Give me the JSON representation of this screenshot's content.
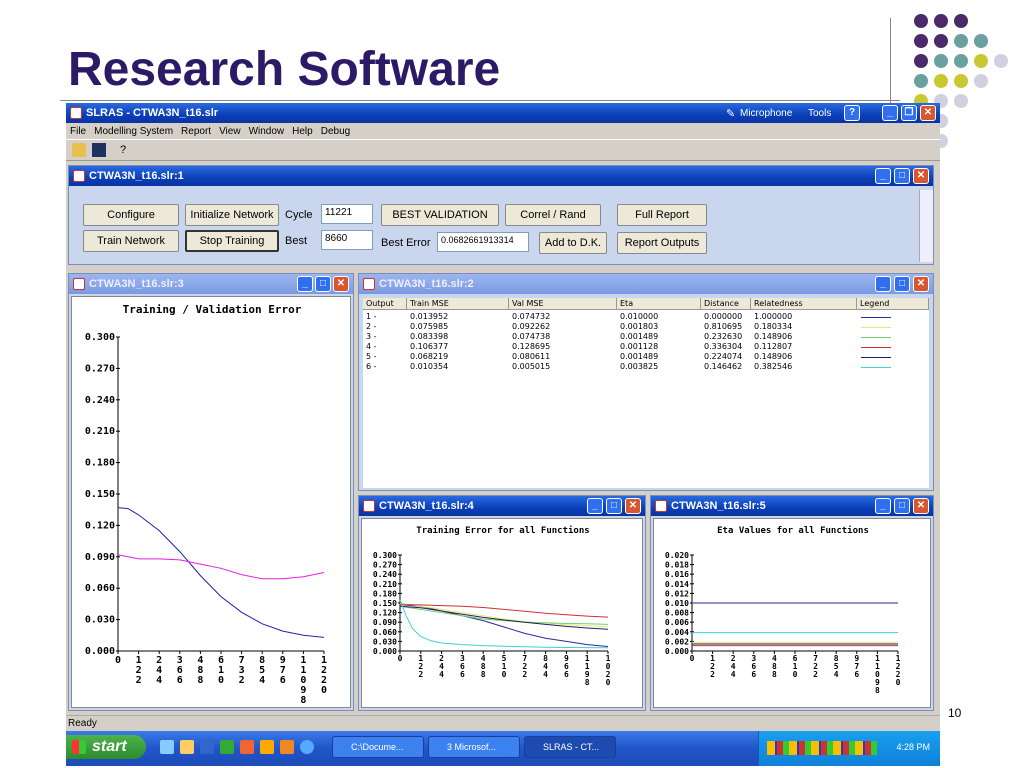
{
  "slide": {
    "title": "Research Software",
    "page_number": "10",
    "dot_colors": [
      "#4b2a6b",
      "#6aa0a0",
      "#c8c832",
      "#d0d0e0"
    ]
  },
  "app": {
    "title": "SLRAS - CTWA3N_t16.slr",
    "top_right": {
      "microphone": "Microphone",
      "tools": "Tools"
    },
    "menu": [
      "File",
      "Modelling System",
      "Report",
      "View",
      "Window",
      "Help",
      "Debug"
    ],
    "status": "Ready"
  },
  "control": {
    "title": "CTWA3N_t16.slr:1",
    "buttons": {
      "configure": "Configure",
      "init_network": "Initialize Network",
      "train_network": "Train Network",
      "stop_training": "Stop Training",
      "best_validation": "BEST VALIDATION",
      "correl_rand": "Correl / Rand",
      "full_report": "Full Report",
      "add_dk": "Add to D.K.",
      "report_outputs": "Report Outputs"
    },
    "labels": {
      "cycle": "Cycle",
      "best": "Best",
      "best_error": "Best Error"
    },
    "values": {
      "cycle": "11221",
      "best": "8660",
      "best_error": "0.0682661913314"
    }
  },
  "win3": {
    "title": "CTWA3N_t16.slr:3"
  },
  "win2": {
    "title": "CTWA3N_t16.slr:2"
  },
  "win4": {
    "title": "CTWA3N_t16.slr:4"
  },
  "win5": {
    "title": "CTWA3N_t16.slr:5"
  },
  "table": {
    "headers": [
      "Output",
      "Train MSE",
      "Val MSE",
      "Eta",
      "Distance",
      "Relatedness",
      "Legend"
    ],
    "rows": [
      {
        "output": "1 -",
        "train": "0.013952",
        "val": "0.074732",
        "eta": "0.010000",
        "dist": "0.000000",
        "rel": "1.000000",
        "color": "#2a2a9a"
      },
      {
        "output": "2 -",
        "train": "0.075985",
        "val": "0.092262",
        "eta": "0.001803",
        "dist": "0.810695",
        "rel": "0.180334",
        "color": "#e8e870"
      },
      {
        "output": "3 -",
        "train": "0.083398",
        "val": "0.074738",
        "eta": "0.001489",
        "dist": "0.232630",
        "rel": "0.148906",
        "color": "#70d070"
      },
      {
        "output": "4 -",
        "train": "0.106377",
        "val": "0.128695",
        "eta": "0.001128",
        "dist": "0.336304",
        "rel": "0.112807",
        "color": "#d03030"
      },
      {
        "output": "5 -",
        "train": "0.068219",
        "val": "0.080611",
        "eta": "0.001489",
        "dist": "0.224074",
        "rel": "0.148906",
        "color": "#202060"
      },
      {
        "output": "6 -",
        "train": "0.010354",
        "val": "0.005015",
        "eta": "0.003825",
        "dist": "0.146462",
        "rel": "0.382546",
        "color": "#40d0d0"
      }
    ]
  },
  "taskbar": {
    "start": "start",
    "tasks": [
      "C:\\Docume...",
      "3 Microsof...",
      "SLRAS - CT..."
    ],
    "clock": "4:28 PM"
  },
  "chart_data": [
    {
      "type": "line",
      "title": "Training / Validation Error",
      "ylim": [
        0,
        0.3
      ],
      "y_ticks": [
        "0.300",
        "0.270",
        "0.240",
        "0.210",
        "0.180",
        "0.150",
        "0.120",
        "0.090",
        "0.060",
        "0.030",
        "0.000"
      ],
      "x_ticks": [
        "0",
        "12\n2",
        "24\n4",
        "36\n6",
        "48\n8",
        "61\n0",
        "73\n2",
        "85\n4",
        "97\n6",
        "110\n98",
        "122\n0"
      ],
      "series": [
        {
          "color": "#2020b0",
          "x": [
            0,
            0.5,
            1,
            2,
            3,
            4,
            5,
            6,
            7,
            8,
            9,
            10
          ],
          "y": [
            0.137,
            0.136,
            0.13,
            0.115,
            0.095,
            0.072,
            0.052,
            0.037,
            0.026,
            0.019,
            0.015,
            0.013
          ]
        },
        {
          "color": "#e020e0",
          "x": [
            0,
            0.5,
            1,
            2,
            3,
            4,
            5,
            6,
            7,
            8,
            9,
            10
          ],
          "y": [
            0.092,
            0.09,
            0.088,
            0.088,
            0.087,
            0.083,
            0.079,
            0.073,
            0.069,
            0.069,
            0.071,
            0.075
          ]
        }
      ]
    },
    {
      "type": "line",
      "title": "Training Error for all Functions",
      "ylim": [
        0,
        0.3
      ],
      "y_ticks": [
        "0.300",
        "0.270",
        "0.240",
        "0.210",
        "0.180",
        "0.150",
        "0.120",
        "0.090",
        "0.060",
        "0.030",
        "0.000"
      ],
      "x_ticks": [
        "0",
        "12\n2",
        "24\n4",
        "36\n6",
        "48\n8",
        "51\n0",
        "72\n2",
        "84\n4",
        "96\n6",
        "119\n8",
        "102\n0"
      ],
      "series": [
        {
          "color": "#2a2a9a",
          "x": [
            0,
            1,
            2,
            3,
            4,
            5,
            6,
            7,
            8,
            9,
            10
          ],
          "y": [
            0.145,
            0.14,
            0.125,
            0.11,
            0.095,
            0.075,
            0.055,
            0.04,
            0.03,
            0.02,
            0.014
          ]
        },
        {
          "color": "#e8e870",
          "x": [
            0,
            1,
            2,
            3,
            4,
            5,
            6,
            7,
            8,
            9,
            10
          ],
          "y": [
            0.15,
            0.14,
            0.13,
            0.12,
            0.11,
            0.1,
            0.092,
            0.087,
            0.082,
            0.079,
            0.076
          ]
        },
        {
          "color": "#70d070",
          "x": [
            0,
            1,
            2,
            3,
            4,
            5,
            6,
            7,
            8,
            9,
            10
          ],
          "y": [
            0.14,
            0.13,
            0.12,
            0.11,
            0.1,
            0.095,
            0.09,
            0.088,
            0.086,
            0.085,
            0.083
          ]
        },
        {
          "color": "#d03030",
          "x": [
            0,
            1,
            2,
            3,
            4,
            5,
            6,
            7,
            8,
            9,
            10
          ],
          "y": [
            0.145,
            0.144,
            0.142,
            0.14,
            0.136,
            0.13,
            0.124,
            0.118,
            0.113,
            0.109,
            0.106
          ]
        },
        {
          "color": "#202060",
          "x": [
            0,
            1,
            2,
            3,
            4,
            5,
            6,
            7,
            8,
            9,
            10
          ],
          "y": [
            0.14,
            0.135,
            0.125,
            0.115,
            0.105,
            0.097,
            0.09,
            0.083,
            0.077,
            0.072,
            0.068
          ]
        },
        {
          "color": "#40d0d0",
          "x": [
            0,
            0.3,
            0.6,
            1,
            1.5,
            2,
            3,
            4,
            5,
            6,
            7,
            8,
            9,
            10
          ],
          "y": [
            0.16,
            0.11,
            0.07,
            0.045,
            0.032,
            0.025,
            0.02,
            0.017,
            0.015,
            0.013,
            0.012,
            0.011,
            0.0105,
            0.0104
          ]
        }
      ]
    },
    {
      "type": "line",
      "title": "Eta Values for all Functions",
      "ylim": [
        0,
        0.02
      ],
      "y_ticks": [
        "0.020",
        "0.018",
        "0.016",
        "0.014",
        "0.012",
        "0.010",
        "0.008",
        "0.006",
        "0.004",
        "0.002",
        "0.000"
      ],
      "x_ticks": [
        "0",
        "12\n2",
        "24\n4",
        "36\n6",
        "48\n8",
        "61\n0",
        "72\n2",
        "85\n4",
        "97\n6",
        "110\n98",
        "122\n0"
      ],
      "series": [
        {
          "color": "#2a2a9a",
          "x": [
            0,
            10
          ],
          "y": [
            0.01,
            0.01
          ]
        },
        {
          "color": "#40d0d0",
          "x": [
            0,
            10
          ],
          "y": [
            0.003825,
            0.003825
          ]
        },
        {
          "color": "#e8e870",
          "x": [
            0,
            10
          ],
          "y": [
            0.001803,
            0.001803
          ]
        },
        {
          "color": "#70d070",
          "x": [
            0,
            10
          ],
          "y": [
            0.001489,
            0.001489
          ]
        },
        {
          "color": "#202060",
          "x": [
            0,
            10
          ],
          "y": [
            0.00145,
            0.00145
          ]
        },
        {
          "color": "#d03030",
          "x": [
            0,
            10
          ],
          "y": [
            0.001128,
            0.001128
          ]
        }
      ]
    }
  ]
}
